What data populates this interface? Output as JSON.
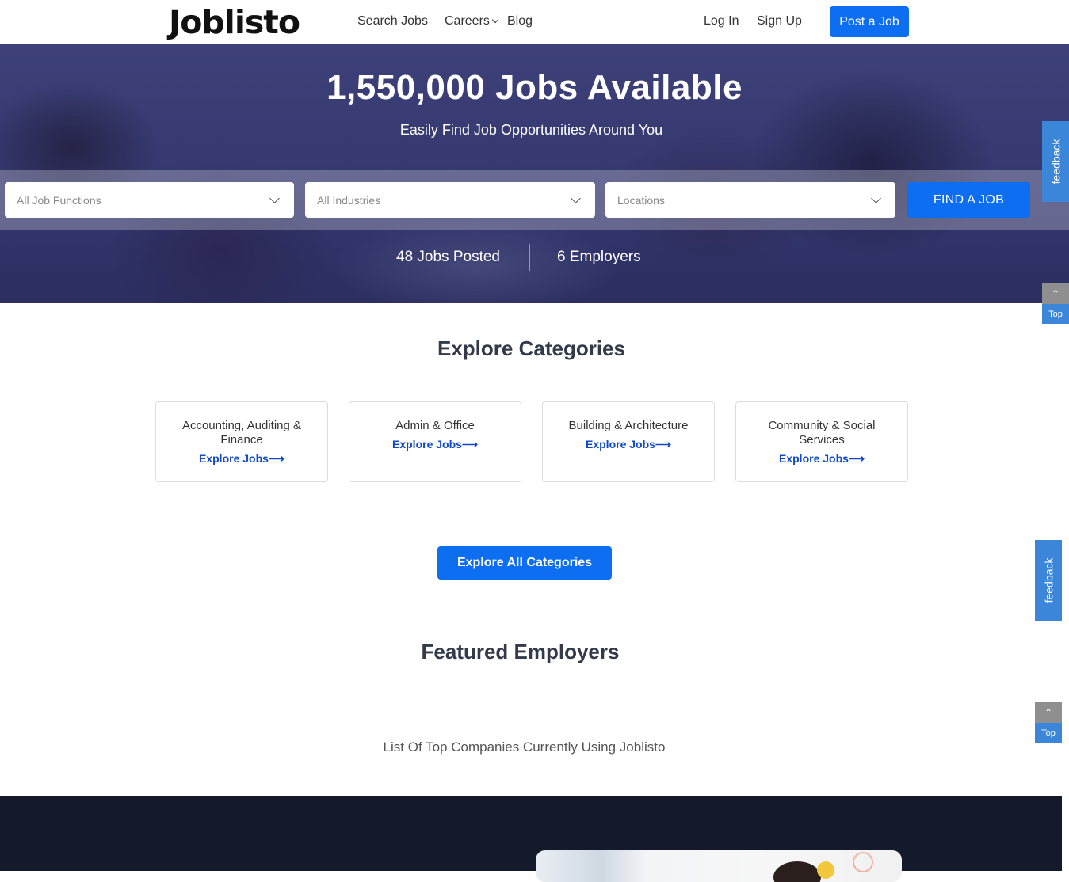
{
  "header": {
    "logo": "Joblisto",
    "nav": {
      "search_jobs": "Search Jobs",
      "careers": "Careers",
      "blog": "Blog"
    },
    "login": "Log In",
    "signup": "Sign Up",
    "post_job": "Post a Job"
  },
  "hero": {
    "title": "1,550,000 Jobs Available",
    "subtitle": "Easily Find Job Opportunities Around You",
    "filters": {
      "job_functions": "All Job Functions",
      "industries": "All Industries",
      "locations": "Locations"
    },
    "find_button": "FIND A JOB",
    "stats": {
      "jobs_posted": "48 Jobs Posted",
      "employers": "6 Employers"
    }
  },
  "widgets": {
    "feedback": "feedback",
    "top": "Top",
    "up_arrow": "⌃"
  },
  "categories": {
    "title": "Explore Categories",
    "items": [
      {
        "name": "Accounting, Auditing & Finance",
        "link": "Explore Jobs⟶"
      },
      {
        "name": "Admin & Office",
        "link": "Explore Jobs⟶"
      },
      {
        "name": "Building & Architecture",
        "link": "Explore Jobs⟶"
      },
      {
        "name": "Community & Social Services",
        "link": "Explore Jobs⟶"
      }
    ],
    "explore_all": "Explore All Categories"
  },
  "employers": {
    "title": "Featured Employers",
    "subtitle": "List Of Top Companies Currently Using Joblisto"
  },
  "colors": {
    "primary": "#0d6ef2",
    "link": "#1249c7",
    "dark_band": "#141a2c",
    "feedback": "#3b86d9"
  }
}
